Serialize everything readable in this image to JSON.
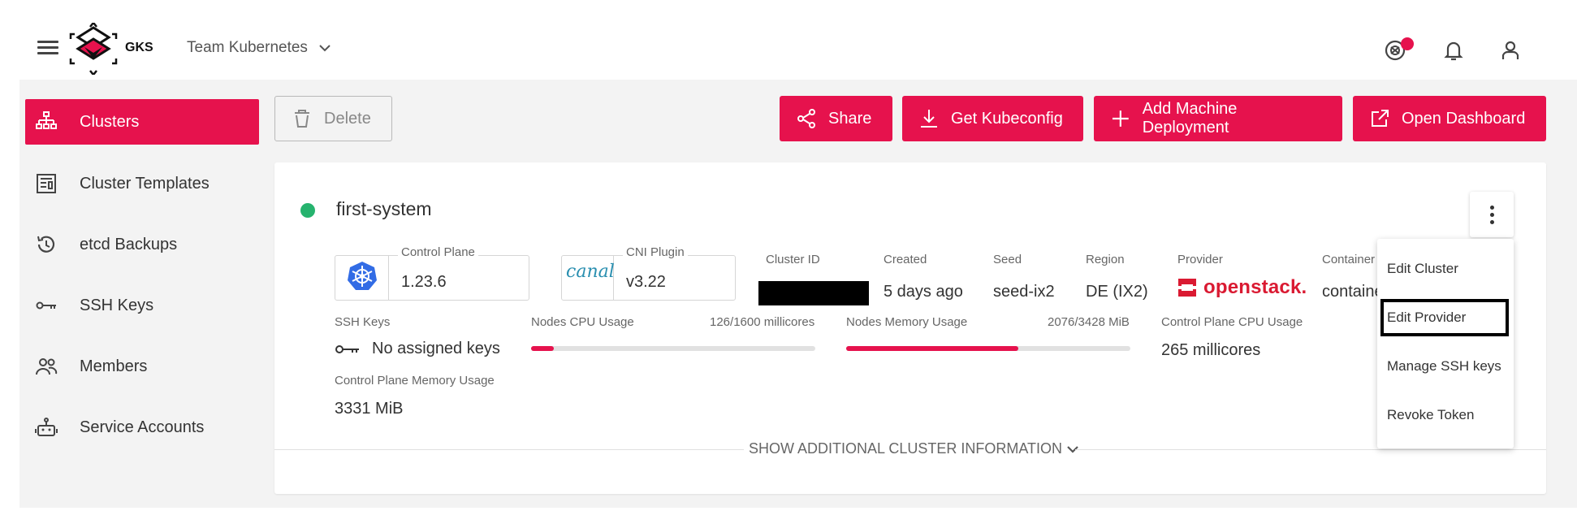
{
  "header": {
    "logo_text": "GKS",
    "team_name": "Team Kubernetes"
  },
  "sidebar": {
    "items": [
      {
        "label": "Clusters",
        "icon": "sitemap-icon"
      },
      {
        "label": "Cluster Templates",
        "icon": "template-icon"
      },
      {
        "label": "etcd Backups",
        "icon": "history-icon"
      },
      {
        "label": "SSH Keys",
        "icon": "key-icon"
      },
      {
        "label": "Members",
        "icon": "members-icon"
      },
      {
        "label": "Service Accounts",
        "icon": "robot-icon"
      }
    ],
    "active": "Clusters"
  },
  "toolbar": {
    "delete_label": "Delete",
    "share_label": "Share",
    "kubeconfig_label": "Get Kubeconfig",
    "add_md_label": "Add Machine Deployment",
    "dashboard_label": "Open Dashboard"
  },
  "cluster": {
    "name": "first-system",
    "status_color": "#26b36e",
    "control_plane_label": "Control Plane",
    "control_plane_value": "1.23.6",
    "cni_label": "CNI Plugin",
    "cni_logo_text": "canal",
    "cni_value": "v3.22",
    "cluster_id_label": "Cluster ID",
    "created_label": "Created",
    "created_value": "5 days ago",
    "seed_label": "Seed",
    "seed_value": "seed-ix2",
    "region_label": "Region",
    "region_value": "DE (IX2)",
    "provider_label": "Provider",
    "provider_value": "openstack.",
    "container_label": "Container",
    "container_value": "containe",
    "ssh_keys_label": "SSH Keys",
    "ssh_keys_value": "No assigned keys",
    "cpu_label": "Nodes CPU Usage",
    "cpu_value": "126/1600 millicores",
    "cpu_fraction": 0.0788,
    "mem_label": "Nodes Memory Usage",
    "mem_value": "2076/3428 MiB",
    "mem_fraction": 0.6056,
    "cp_cpu_label": "Control Plane CPU Usage",
    "cp_cpu_value": "265 millicores",
    "cp_mem_label": "Control Plane Memory Usage",
    "cp_mem_value": "3331 MiB",
    "show_more_label": "SHOW ADDITIONAL CLUSTER INFORMATION"
  },
  "menu": {
    "items": [
      "Edit Cluster",
      "Edit Provider",
      "Manage SSH keys",
      "Revoke Token"
    ],
    "focused": "Edit Provider"
  },
  "colors": {
    "accent": "#e6124d",
    "status_green": "#26b36e",
    "openstack_red": "#da1a32"
  }
}
